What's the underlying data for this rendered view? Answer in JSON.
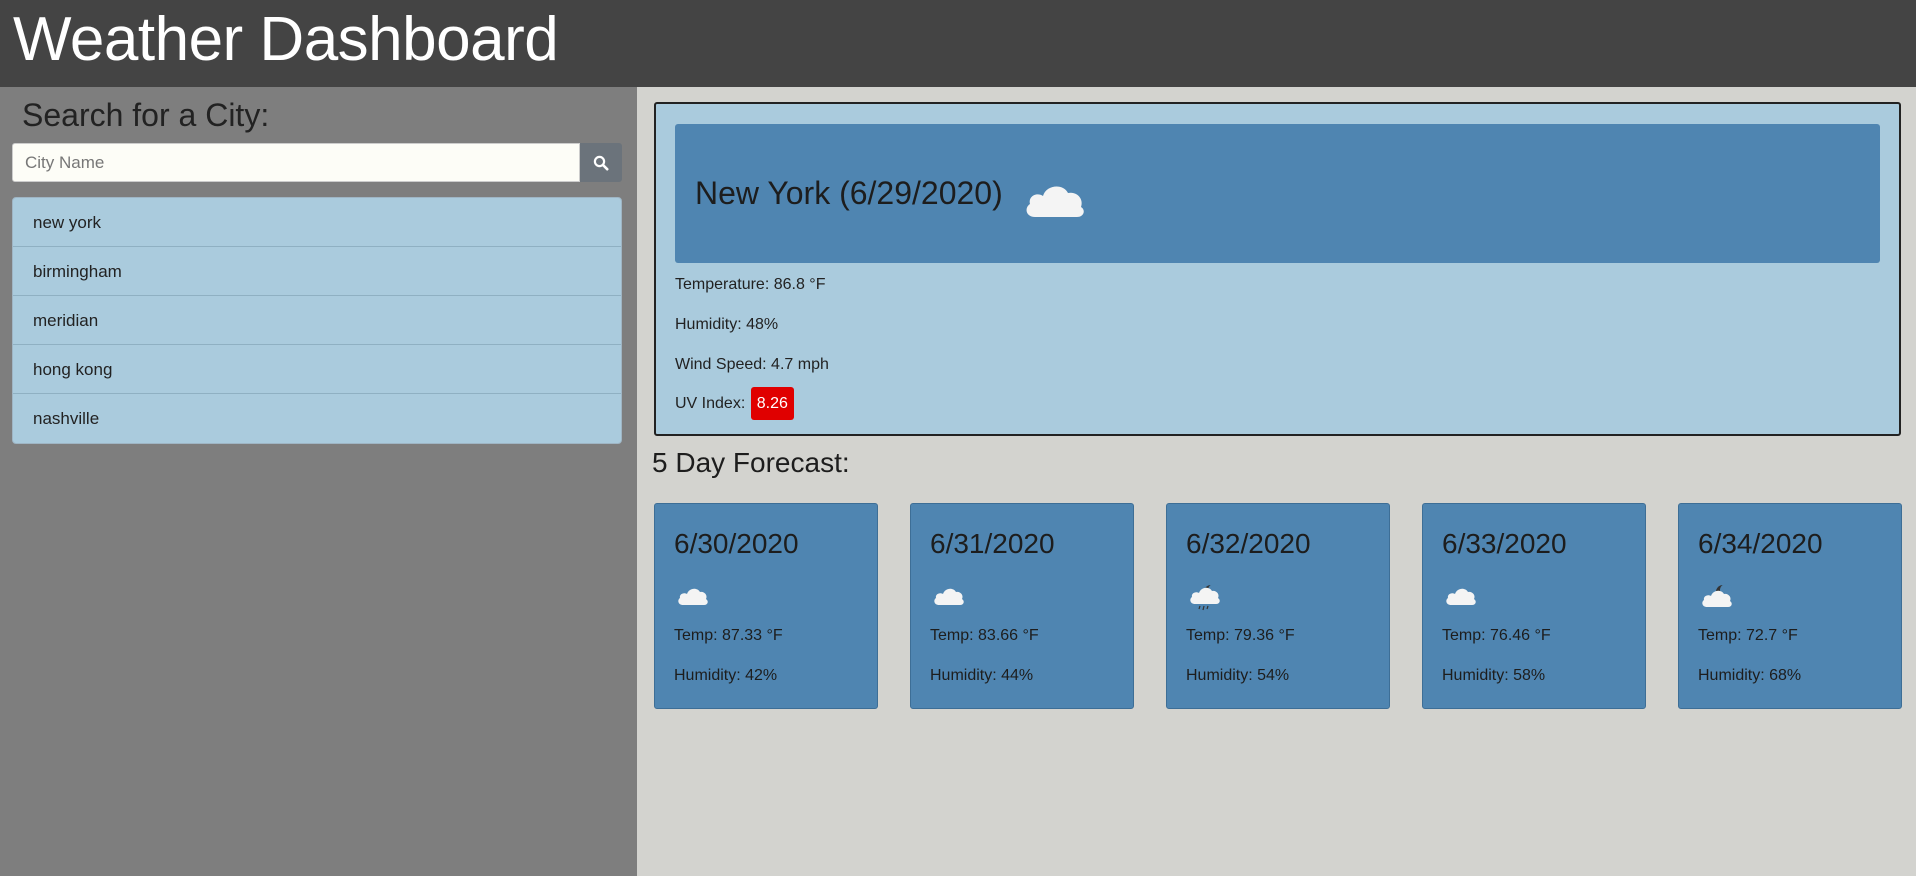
{
  "header": {
    "title": "Weather Dashboard"
  },
  "sidebar": {
    "search_title": "Search for a City:",
    "search_placeholder": "City Name",
    "search_icon": "search-icon",
    "cities": [
      "new york",
      "birmingham",
      "meridian",
      "hong kong",
      "nashville"
    ]
  },
  "current": {
    "title": "New York (6/29/2020)",
    "icon": "cloud-icon",
    "temperature": "Temperature: 86.8 °F",
    "humidity": "Humidity: 48%",
    "wind": "Wind Speed: 4.7 mph",
    "uv_label": "UV Index:",
    "uv_value": "8.26",
    "uv_color": "#e00000"
  },
  "forecast": {
    "title": "5 Day Forecast:",
    "days": [
      {
        "date": "6/30/2020",
        "icon": "cloud-icon",
        "temp": "Temp: 87.33 °F",
        "humidity": "Humidity: 42%"
      },
      {
        "date": "6/31/2020",
        "icon": "cloud-icon",
        "temp": "Temp: 83.66 °F",
        "humidity": "Humidity: 44%"
      },
      {
        "date": "6/32/2020",
        "icon": "night-rain-icon",
        "temp": "Temp: 79.36 °F",
        "humidity": "Humidity: 54%"
      },
      {
        "date": "6/33/2020",
        "icon": "cloud-icon",
        "temp": "Temp: 76.46 °F",
        "humidity": "Humidity: 58%"
      },
      {
        "date": "6/34/2020",
        "icon": "night-cloud-icon",
        "temp": "Temp: 72.7 °F",
        "humidity": "Humidity: 68%"
      }
    ]
  },
  "colors": {
    "header_bg": "#444444",
    "sidebar_bg": "#7e7e7e",
    "card_light": "#aacbdd",
    "card_dark": "#4f85b1",
    "main_bg": "#d3d3cf"
  }
}
